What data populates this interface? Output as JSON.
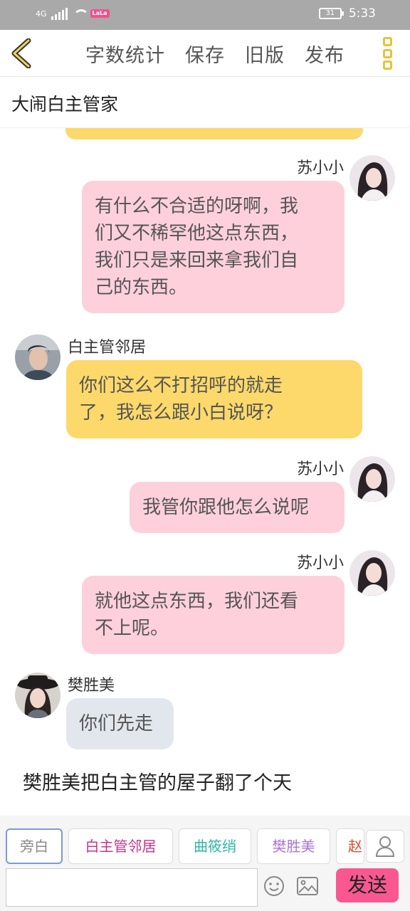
{
  "status_bar": {
    "network": "4G",
    "badge": "LaLa",
    "battery": "31",
    "time": "5:33"
  },
  "toolbar": {
    "actions": [
      "字数统计",
      "保存",
      "旧版",
      "发布"
    ]
  },
  "story_title": "大闹白主管家",
  "messages": [
    {
      "speaker": "苏小小",
      "side": "right",
      "text_lines": [
        "有什么不合适的呀啊，我",
        "们又不稀罕他这点东西，",
        "我们只是来回来拿我们自",
        "己的东西。"
      ]
    },
    {
      "speaker": "白主管邻居",
      "side": "left",
      "text_lines": [
        "你们这么不打招呼的就走",
        "了，我怎么跟小白说呀？"
      ]
    },
    {
      "speaker": "苏小小",
      "side": "right",
      "text_lines": [
        "我管你跟他怎么说呢"
      ]
    },
    {
      "speaker": "苏小小",
      "side": "right",
      "text_lines": [
        "就他这点东西，我们还看",
        "不上呢。"
      ]
    },
    {
      "speaker": "樊胜美",
      "side": "left",
      "text_lines": [
        "你们先走"
      ]
    }
  ],
  "narration": "樊胜美把白主管的屋子翻了个天",
  "role_chips": [
    {
      "label": "旁白",
      "color": "#8a8a8a"
    },
    {
      "label": "白主管邻居",
      "color": "#c8338a"
    },
    {
      "label": "曲筱绡",
      "color": "#2fb5a4"
    },
    {
      "label": "樊胜美",
      "color": "#a975d6"
    },
    {
      "label": "赵",
      "color": "#e04a2f"
    }
  ],
  "input": {
    "placeholder": ""
  },
  "send_label": "发送",
  "colors": {
    "accent_yellow": "#fcd96a",
    "pink_bubble": "#fdd0dc",
    "send": "#f8588f"
  }
}
